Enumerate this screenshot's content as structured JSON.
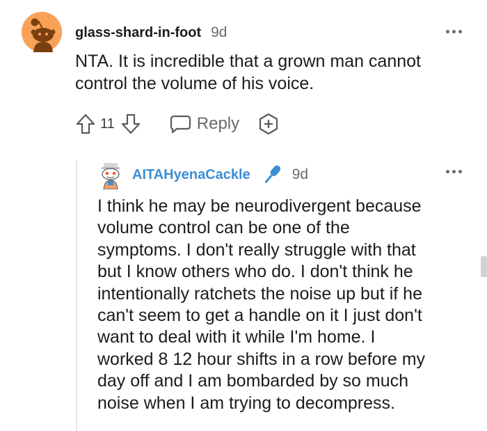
{
  "comment": {
    "username": "glass-shard-in-foot",
    "age": "9d",
    "body": "NTA. It is incredible that a grown man cannot control the volume of his voice.",
    "score": "11",
    "reply_label": "Reply",
    "avatar_color": "#f7a257",
    "icons": [
      "upvote-icon",
      "downvote-icon",
      "reply-bubble-icon",
      "award-plus-icon",
      "more-options-icon"
    ]
  },
  "reply": {
    "username": "AITAHyenaCackle",
    "username_color": "#3d8ed4",
    "age": "9d",
    "flair_icon": "microphone-icon",
    "body_lines": [
      "I think he may be neurodivergent because",
      "volume control can be one of the",
      "symptoms. I don't really struggle with that",
      "but I know others who do. I don't think he",
      "intentionally ratchets the noise up but if he",
      "can't seem to get a handle on it I just don't",
      "want to deal with it while I'm home. I",
      "worked 8 12 hour shifts in a row before my",
      "day off and I am bombarded by so much",
      "noise when I am trying to decompress."
    ]
  }
}
